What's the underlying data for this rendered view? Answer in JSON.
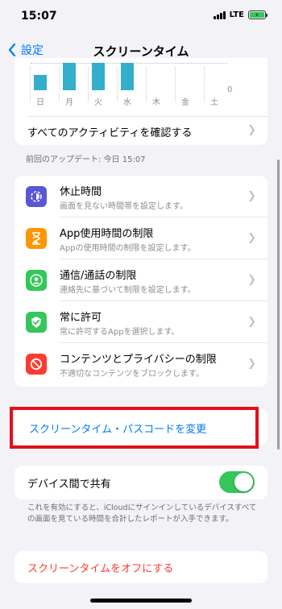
{
  "status": {
    "time": "15:07",
    "network": "LTE"
  },
  "nav": {
    "back_label": "設定",
    "title": "スクリーンタイム"
  },
  "chart": {
    "days": [
      "日",
      "月",
      "火",
      "水",
      "木",
      "金",
      "土"
    ],
    "zero_label": "0",
    "all_activity": "すべてのアクティビティを確認する"
  },
  "chart_data": {
    "type": "bar",
    "categories": [
      "日",
      "月",
      "火",
      "水",
      "木",
      "金",
      "土"
    ],
    "values": [
      0.55,
      1.0,
      1.0,
      1.0,
      0,
      0,
      0
    ],
    "ylabel": "",
    "ylim": [
      0,
      1
    ]
  },
  "update_caption": "前回のアップデート: 今日 15:07",
  "menu": {
    "items": [
      {
        "title": "休止時間",
        "subtitle": "画面を見ない時間帯を設定します。",
        "color": "#5856d6",
        "icon": "downtime-icon"
      },
      {
        "title": "App使用時間の制限",
        "subtitle": "Appの使用時間の制限を設定します。",
        "color": "#ff9500",
        "icon": "hourglass-icon"
      },
      {
        "title": "通信/通話の制限",
        "subtitle": "連絡先に基づいて制限を設定します。",
        "color": "#34c759",
        "icon": "contact-icon"
      },
      {
        "title": "常に許可",
        "subtitle": "常に許可するAppを選択します。",
        "color": "#34c759",
        "icon": "checkmark-shield-icon"
      },
      {
        "title": "コンテンツとプライバシーの制限",
        "subtitle": "不適切なコンテンツをブロックします。",
        "color": "#ff3b30",
        "icon": "restriction-icon"
      }
    ]
  },
  "passcode": {
    "label": "スクリーンタイム・パスコードを変更"
  },
  "share": {
    "label": "デバイス間で共有",
    "enabled": true,
    "caption": "これを有効にすると、iCloudにサインインしているデバイスすべての画面を見ている時間を合計したレポートが入手できます。"
  },
  "turn_off": {
    "label": "スクリーンタイムをオフにする"
  },
  "colors": {
    "accent": "#007aff",
    "bar": "#33aecc",
    "toggle_on": "#34c759",
    "destructive": "#ff3b30",
    "highlight": "#e3101a"
  }
}
